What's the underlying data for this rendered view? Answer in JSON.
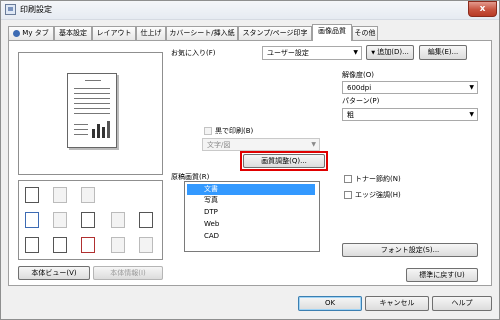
{
  "window": {
    "title": "印刷設定",
    "close_glyph": "x"
  },
  "tabs": [
    {
      "label": "My タブ",
      "active": false
    },
    {
      "label": "基本設定",
      "active": false
    },
    {
      "label": "レイアウト",
      "active": false
    },
    {
      "label": "仕上げ",
      "active": false
    },
    {
      "label": "カバーシート/挿入紙",
      "active": false
    },
    {
      "label": "スタンプ/ページ印字",
      "active": false
    },
    {
      "label": "画像品質",
      "active": true
    },
    {
      "label": "その他",
      "active": false
    }
  ],
  "favorites": {
    "label": "お気に入り(F)",
    "value": "ユーザー設定",
    "add_button": "追加(D)...",
    "edit_button": "編集(E)..."
  },
  "preview": {
    "view_button": "本体ビュー(V)",
    "info_button": "本体情報(I)"
  },
  "mono": {
    "label": "黒で印刷(B)",
    "select_value": "文字/図"
  },
  "image_adjust_button": "画質調整(Q)...",
  "original_type": {
    "label": "原稿画質(R)",
    "items": [
      "文書",
      "写真",
      "DTP",
      "Web",
      "CAD"
    ],
    "selected_index": 0
  },
  "resolution": {
    "label": "解像度(O)",
    "value": "600dpi"
  },
  "pattern": {
    "label": "パターン(P)",
    "value": "粗"
  },
  "toner_save": {
    "label": "トナー節約(N)"
  },
  "edge_enhance": {
    "label": "エッジ強調(H)"
  },
  "font_settings_button": "フォント設定(S)...",
  "restore_defaults_button": "標準に戻す(U)",
  "footer": {
    "ok": "OK",
    "cancel": "キャンセル",
    "help": "ヘルプ"
  },
  "icons": {
    "title": "printer-icon",
    "my_tab": "person-icon"
  }
}
